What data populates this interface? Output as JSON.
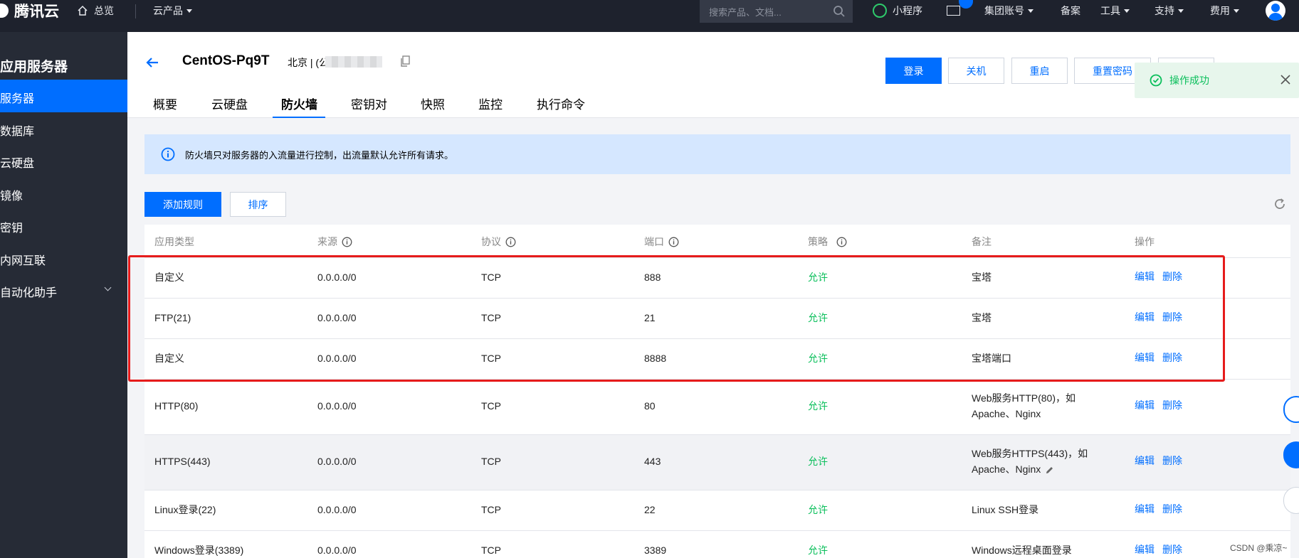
{
  "topbar": {
    "brand": "腾讯云",
    "home": "总览",
    "products": "云产品",
    "search_placeholder": "搜索产品、文档...",
    "mini_program": "小程序",
    "group_account": "集团账号",
    "record": "备案",
    "tools": "工具",
    "support": "支持",
    "billing": "费用"
  },
  "sidebar": {
    "title": "应用服务器",
    "items": [
      {
        "label": "服务器"
      },
      {
        "label": "数据库"
      },
      {
        "label": "云硬盘"
      },
      {
        "label": "镜像"
      },
      {
        "label": "密钥"
      },
      {
        "label": "内网互联"
      },
      {
        "label": "自动化助手"
      }
    ]
  },
  "header": {
    "instance_name": "CentOS-Pq9T",
    "region": "北京 | (公",
    "buttons": {
      "login": "登录",
      "shutdown": "关机",
      "restart": "重启",
      "reset_password": "重置密码"
    },
    "tabs": [
      "概要",
      "云硬盘",
      "防火墙",
      "密钥对",
      "快照",
      "监控",
      "执行命令"
    ],
    "active_tab": "防火墙"
  },
  "toast": {
    "text": "操作成功"
  },
  "banner": {
    "text": "防火墙只对服务器的入流量进行控制，出流量默认允许所有请求。"
  },
  "toolbar": {
    "add_rule": "添加规则",
    "sort": "排序"
  },
  "table": {
    "columns": [
      "应用类型",
      "来源",
      "协议",
      "端口",
      "策略",
      "备注",
      "操作"
    ],
    "actions": {
      "edit": "编辑",
      "delete": "删除"
    },
    "rows": [
      {
        "type": "自定义",
        "source": "0.0.0.0/0",
        "protocol": "TCP",
        "port": "888",
        "policy": "允许",
        "note": "宝塔"
      },
      {
        "type": "FTP(21)",
        "source": "0.0.0.0/0",
        "protocol": "TCP",
        "port": "21",
        "policy": "允许",
        "note": "宝塔"
      },
      {
        "type": "自定义",
        "source": "0.0.0.0/0",
        "protocol": "TCP",
        "port": "8888",
        "policy": "允许",
        "note": "宝塔端口"
      },
      {
        "type": "HTTP(80)",
        "source": "0.0.0.0/0",
        "protocol": "TCP",
        "port": "80",
        "policy": "允许",
        "note": "Web服务HTTP(80)，如 Apache、Nginx"
      },
      {
        "type": "HTTPS(443)",
        "source": "0.0.0.0/0",
        "protocol": "TCP",
        "port": "443",
        "policy": "允许",
        "note": "Web服务HTTPS(443)，如 Apache、Nginx"
      },
      {
        "type": "Linux登录(22)",
        "source": "0.0.0.0/0",
        "protocol": "TCP",
        "port": "22",
        "policy": "允许",
        "note": "Linux SSH登录"
      },
      {
        "type": "Windows登录(3389)",
        "source": "0.0.0.0/0",
        "protocol": "TCP",
        "port": "3389",
        "policy": "允许",
        "note": "Windows远程桌面登录"
      }
    ]
  },
  "watermark": "CSDN @乘凉~",
  "colors": {
    "primary": "#006eff",
    "allow": "#0abf5b",
    "highlight": "#e61b1b",
    "sidebar_bg": "#262b36",
    "topbar_bg": "#1e222d"
  }
}
